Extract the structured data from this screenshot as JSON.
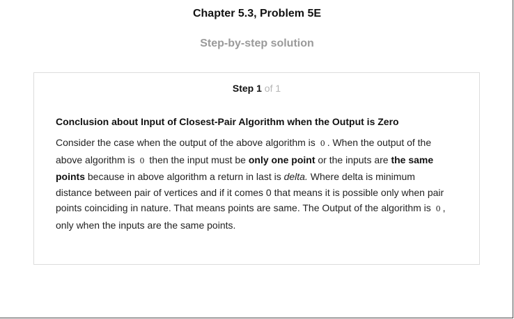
{
  "header": {
    "chapter_title": "Chapter 5.3, Problem 5E",
    "subtitle": "Step-by-step solution"
  },
  "step": {
    "label": "Step",
    "number": "1",
    "of_text": "of 1"
  },
  "solution": {
    "heading": "Conclusion about Input of Closest-Pair Algorithm when the Output is Zero",
    "zero_symbol": "0",
    "seg1": "Consider the case when the output of the above algorithm is ",
    "seg2": ". When the output of the above algorithm is ",
    "seg3": " then the input must be ",
    "bold1": "only one point",
    "seg4": " or the inputs are ",
    "bold2": "the same points",
    "seg5": " because in above algorithm a return in last is ",
    "italic1": "delta.",
    "seg6": " Where delta is minimum distance between pair of vertices and if it comes 0 that means it is possible only when pair points coinciding in nature. That means points are same. The Output of the algorithm is ",
    "seg7": ", only when the inputs are the same points."
  }
}
